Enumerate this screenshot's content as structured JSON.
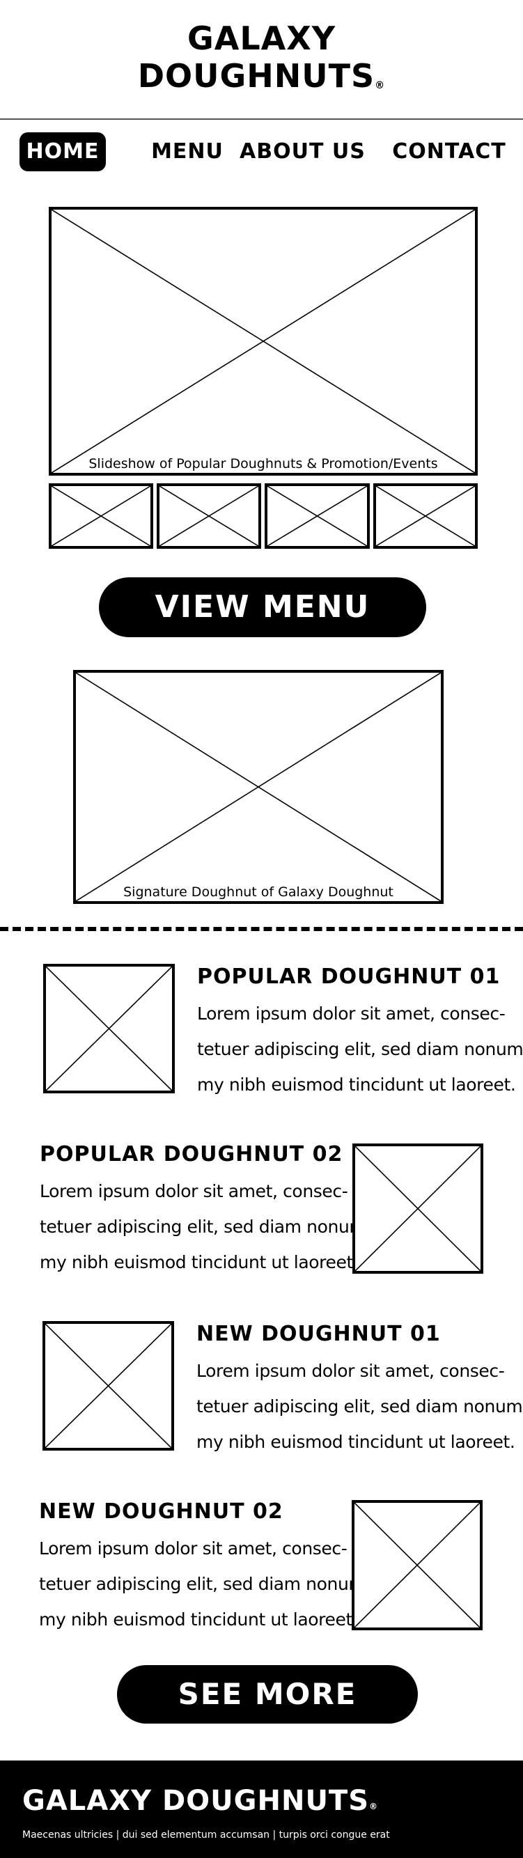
{
  "brand": {
    "line1": "Galaxy",
    "line2": "Doughnuts",
    "reg_mark": "®"
  },
  "nav": {
    "items": [
      {
        "label": "Home",
        "active": true
      },
      {
        "label": "Menu"
      },
      {
        "label": "About Us"
      },
      {
        "label": "Contact"
      }
    ]
  },
  "hero": {
    "caption": "Slideshow of Popular Doughnuts & Promotion/Events",
    "thumbnail_count": 4
  },
  "view_menu_label": "View Menu",
  "signature": {
    "caption": "Signature Doughnut of Galaxy Doughnut"
  },
  "products": [
    {
      "title": "Popular Doughnut 01",
      "lines": [
        "Lorem ipsum dolor sit amet, consec-",
        "tetuer adipiscing elit, sed diam nonum-",
        "my nibh euismod tincidunt ut laoreet."
      ]
    },
    {
      "title": "Popular Doughnut 02",
      "lines": [
        "Lorem ipsum dolor sit amet, consec-",
        "tetuer adipiscing elit, sed diam nonum-",
        "my nibh euismod tincidunt ut laoreet."
      ]
    },
    {
      "title": "New Doughnut 01",
      "lines": [
        "Lorem ipsum dolor sit amet, consec-",
        "tetuer adipiscing elit, sed diam nonum-",
        "my nibh euismod tincidunt ut laoreet."
      ]
    },
    {
      "title": "New Doughnut 02",
      "lines": [
        "Lorem ipsum dolor sit amet, consec-",
        "tetuer adipiscing elit, sed diam nonum-",
        "my nibh euismod tincidunt ut laoreet."
      ]
    }
  ],
  "see_more_label": "See More",
  "footer": {
    "brand": "Galaxy Doughnuts",
    "reg_mark": "®",
    "tagline": "Maecenas ultricies | dui sed elementum accumsan | turpis orci congue erat"
  },
  "colors": {
    "primary": "#000000",
    "background": "#ffffff",
    "divider": "#555555"
  }
}
